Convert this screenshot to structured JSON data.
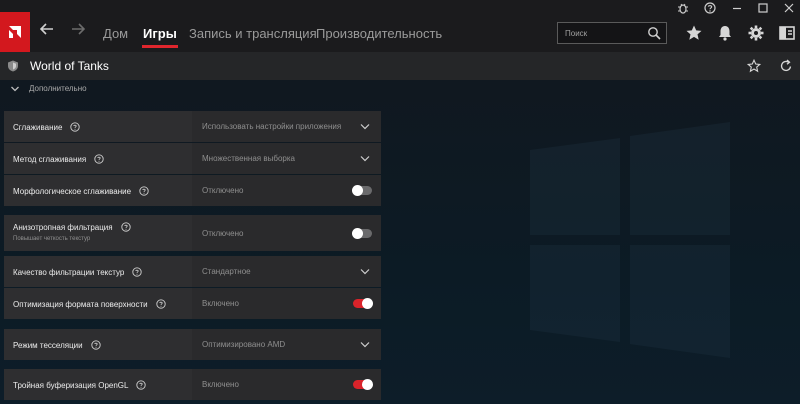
{
  "nav": {
    "tabs": [
      {
        "label": "Дом",
        "active": false
      },
      {
        "label": "Игры",
        "active": true
      },
      {
        "label": "Запись и трансляция",
        "active": false
      },
      {
        "label": "Производительность",
        "active": false
      }
    ],
    "search_placeholder": "Поиск"
  },
  "game": {
    "title": "World of Tanks"
  },
  "section": {
    "label": "Дополнительно"
  },
  "settings": [
    {
      "label": "Сглаживание",
      "value": "Использовать настройки приложения",
      "control": "dropdown"
    },
    {
      "label": "Метод сглаживания",
      "value": "Множественная выборка",
      "control": "dropdown"
    },
    {
      "label": "Морфологическое сглаживание",
      "value": "Отключено",
      "control": "toggle",
      "on": false
    },
    {
      "label": "Анизотропная фильтрация",
      "sublabel": "Повышает четкость текстур",
      "value": "Отключено",
      "control": "toggle",
      "on": false
    },
    {
      "label": "Качество фильтрации текстур",
      "value": "Стандартное",
      "control": "dropdown"
    },
    {
      "label": "Оптимизация формата поверхности",
      "value": "Включено",
      "control": "toggle",
      "on": true
    },
    {
      "label": "Режим тесселяции",
      "value": "Оптимизировано AMD",
      "control": "dropdown"
    },
    {
      "label": "Тройная буферизация OpenGL",
      "value": "Включено",
      "control": "toggle",
      "on": true
    }
  ],
  "colors": {
    "accent": "#e0262d",
    "topbar": "#1b1b1d",
    "row": "#2a2a2c"
  },
  "icons": [
    "amd-logo",
    "back-arrow",
    "forward-arrow",
    "search-icon",
    "star-icon",
    "bell-icon",
    "gear-icon",
    "panel-icon",
    "bug-icon",
    "help-icon",
    "minimize-icon",
    "maximize-icon",
    "close-icon",
    "tank-icon",
    "refresh-icon",
    "chevron-down-icon",
    "question-icon"
  ]
}
